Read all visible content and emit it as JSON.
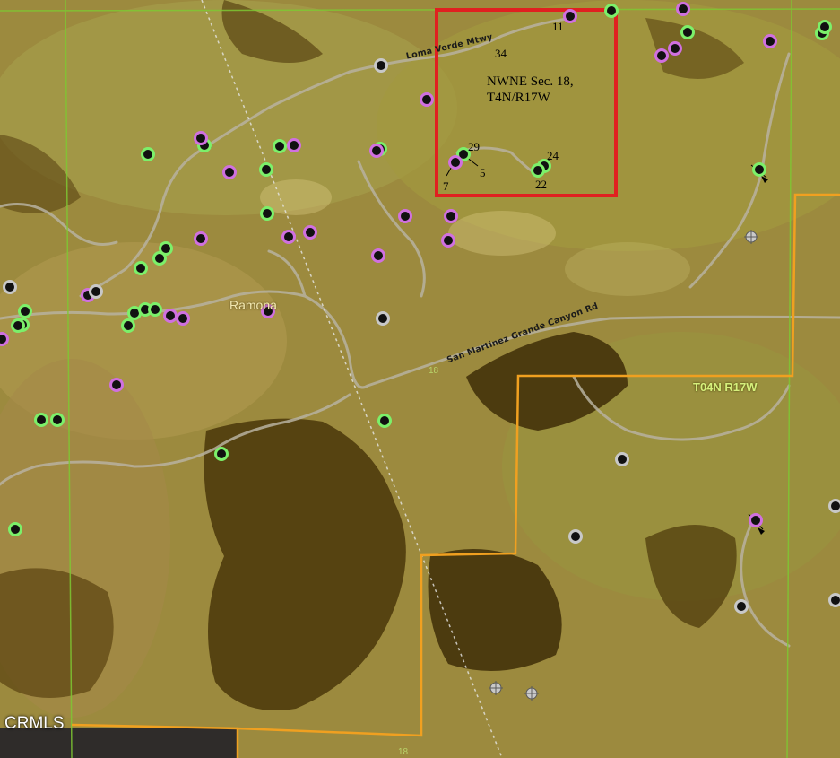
{
  "map": {
    "section_label": [
      "NWNE Sec. 18,",
      "T4N/R17W"
    ],
    "roads": {
      "loma_verde": "Loma Verde Mtwy",
      "san_martinez": "San Martinez Grande Canyon Rd"
    },
    "route_marker": "18",
    "route_marker_bottom": "18",
    "place_name": "Ramona",
    "township_label": "T04N R17W",
    "credit": "CRMLS",
    "well_numbers": {
      "n11": "11",
      "n34": "34",
      "n29": "29",
      "n24": "24",
      "n5": "5",
      "n7": "7",
      "n22": "22"
    },
    "colors": {
      "subject_box": "#e02020",
      "township_line": "#f0a020",
      "section_line": "#7ec832",
      "well_active": "#7cf06a",
      "well_other": "#d070e0",
      "well_plugged": "#c8c8c8"
    }
  }
}
